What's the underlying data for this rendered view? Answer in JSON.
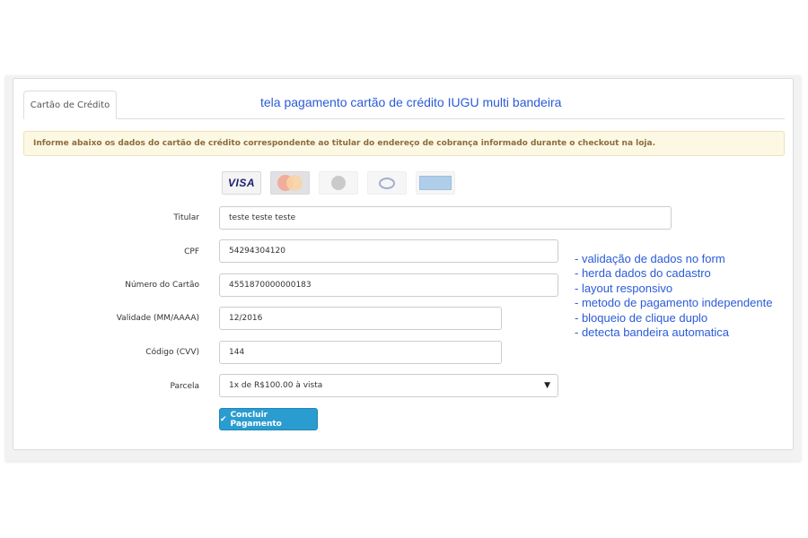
{
  "tab": {
    "label": "Cartão de Crédito"
  },
  "annotation_title": "tela pagamento cartão de crédito IUGU multi bandeira",
  "alert": {
    "text": "Informe abaixo os dados do cartão de crédito correspondente ao titular do endereço de cobrança informado durante o checkout na loja."
  },
  "brands": [
    {
      "name": "visa",
      "label": "VISA",
      "active": true
    },
    {
      "name": "mastercard",
      "active": false
    },
    {
      "name": "elo",
      "active": false
    },
    {
      "name": "diners",
      "active": false
    },
    {
      "name": "amex",
      "active": false
    }
  ],
  "form": {
    "titular": {
      "label": "Titular",
      "value": "teste teste teste"
    },
    "cpf": {
      "label": "CPF",
      "value": "54294304120"
    },
    "numero": {
      "label": "Número do Cartão",
      "value": "4551870000000183"
    },
    "validade": {
      "label": "Validade (MM/AAAA)",
      "value": "12/2016"
    },
    "cvv": {
      "label": "Código (CVV)",
      "value": "144"
    },
    "parcela": {
      "label": "Parcela",
      "value": "1x de R$100.00 à vista"
    }
  },
  "submit": {
    "icon": "✔",
    "label": "Concluir Pagamento"
  },
  "notes": [
    "- validação de dados no form",
    "- herda dados do cadastro",
    "- layout responsivo",
    "- metodo de pagamento independente",
    "- bloqueio de clique duplo",
    "- detecta bandeira automatica"
  ],
  "colors": {
    "accent_button": "#2b9ccf",
    "annotation_text": "#2a5bd7",
    "alert_bg": "#fcf8e3",
    "alert_text": "#8a6d3b"
  }
}
